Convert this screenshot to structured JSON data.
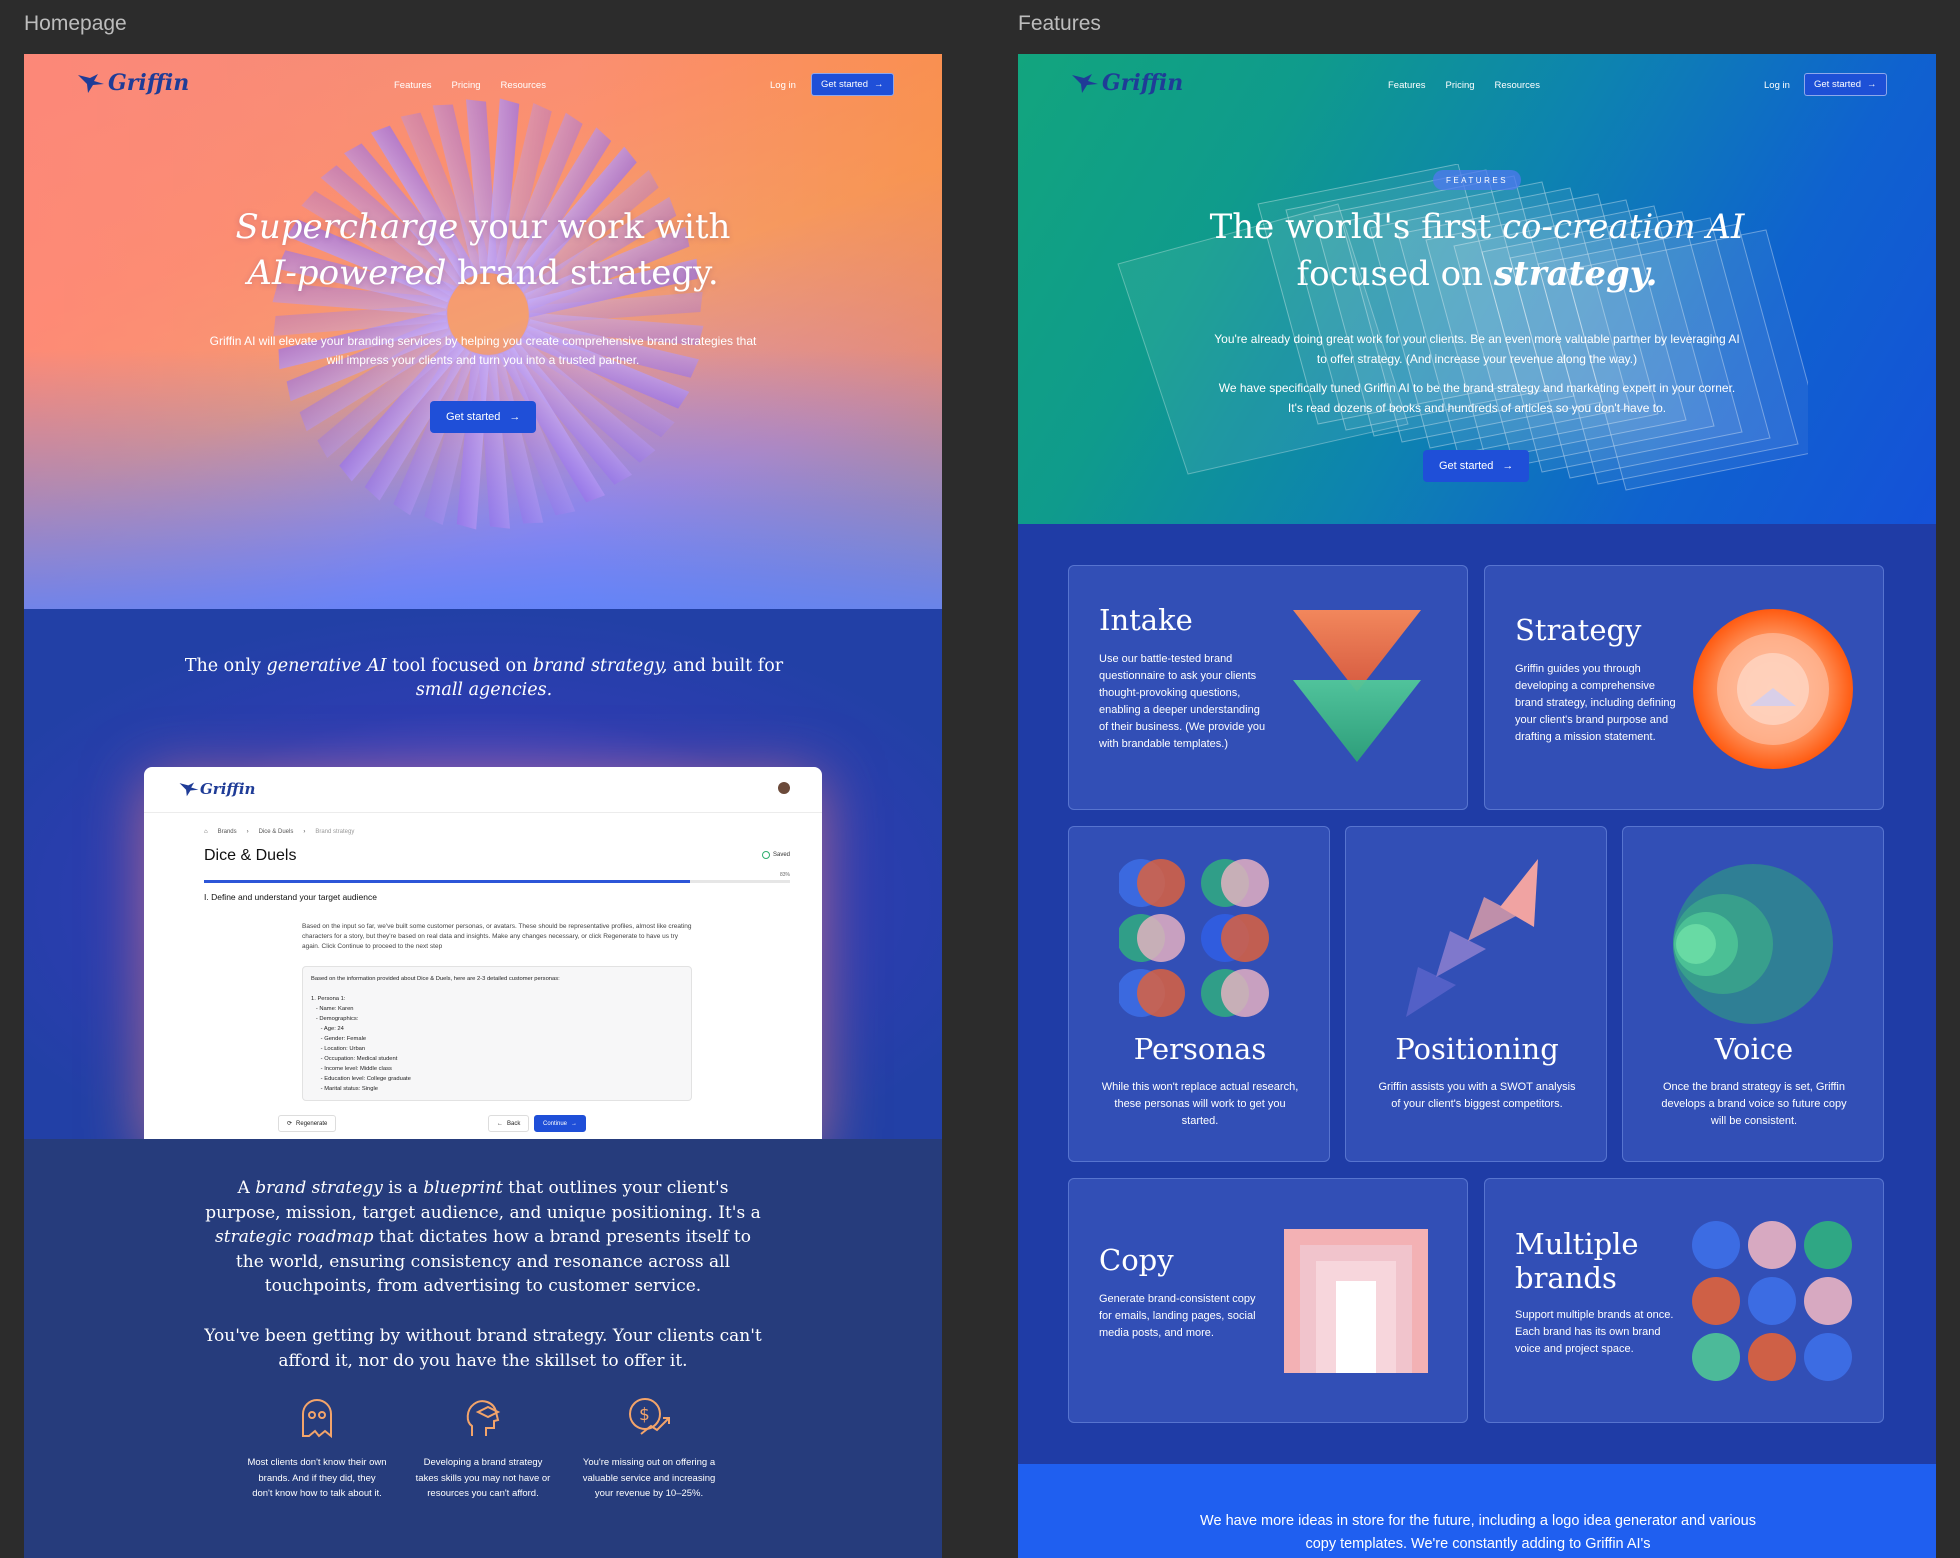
{
  "frames": {
    "homepage_label": "Homepage",
    "features_label": "Features"
  },
  "nav": {
    "brand": "Griffin",
    "links": [
      "Features",
      "Pricing",
      "Resources"
    ],
    "login": "Log in",
    "cta": "Get started"
  },
  "home": {
    "hero_title_1a": "Supercharge",
    "hero_title_1b": " your work with",
    "hero_title_2a": "AI-powered",
    "hero_title_2b": " brand strategy.",
    "hero_sub": "Griffin AI will elevate your branding services by helping you create comprehensive brand strategies that will impress your clients and turn you into a trusted partner.",
    "hero_cta": "Get started",
    "s2_a": "The only ",
    "s2_b": "generative AI",
    "s2_c": " tool focused on ",
    "s2_d": "brand strategy,",
    "s2_e": " and built for ",
    "s2_f": "small agencies.",
    "app": {
      "brand": "Griffin",
      "crumbs": [
        "Brands",
        "Dice & Duels",
        "Brand strategy"
      ],
      "title": "Dice & Duels",
      "saved": "Saved",
      "percent": "83%",
      "progress": 0.83,
      "step": "I. Define and understand your target audience",
      "explain": "Based on the input so far, we've built some customer personas, or avatars. These should be representative profiles, almost like creating characters for a story, but they're based on real data and insights. Make any changes necessary, or click Regenerate to have us try again. Click Continue to proceed to the next step",
      "response": [
        "Based on the information provided about Dice & Duels, here are 2-3 detailed customer personas:",
        "",
        "1. Persona 1:",
        "   - Name: Karen",
        "   - Demographics:",
        "      - Age: 24",
        "      - Gender: Female",
        "      - Location: Urban",
        "      - Occupation: Medical student",
        "      - Income level: Middle class",
        "      - Education level: College graduate",
        "      - Marital status: Single"
      ],
      "regenerate": "Regenerate",
      "back": "Back",
      "continue": "Continue"
    },
    "s3_p1": [
      "A ",
      "brand strategy",
      " is a ",
      "blueprint",
      " that outlines your client's purpose, mission, target audience, and unique positioning. It's a ",
      "strategic roadmap",
      " that dictates how a brand presents itself to the world, ensuring consistency and resonance across all touchpoints, from advertising to customer service."
    ],
    "s3_p2": "You've been getting by without brand strategy. Your clients can't afford it, nor do you have the skillset to offer it.",
    "pains": [
      {
        "icon": "ghost-icon",
        "text": "Most clients don't know their own brands. And if they did, they don't know how to talk about it."
      },
      {
        "icon": "head-graduation-icon",
        "text": "Developing a brand strategy takes skills you may not have or resources you can't afford."
      },
      {
        "icon": "revenue-chart-icon",
        "text": "You're missing out on offering a valuable service and increasing your revenue by 10–25%."
      }
    ]
  },
  "features": {
    "pill": "FEATURES",
    "title_1a": "The world's first ",
    "title_1b": "co-creation AI",
    "title_2a": "focused on ",
    "title_2b": "strategy.",
    "sub1": "You're already doing great work for your clients. Be an even more valuable partner by leveraging AI to offer strategy. (And increase your revenue along the way.)",
    "sub2": "We have specifically tuned Griffin AI to be the brand strategy and marketing expert in your corner. It's read dozens of books and hundreds of articles so you don't have to.",
    "cta": "Get started",
    "cards": {
      "intake": {
        "title": "Intake",
        "text": "Use our battle-tested brand questionnaire to ask your clients thought-provoking questions, enabling a deeper understanding of their business. (We provide you with brandable templates.)"
      },
      "strategy": {
        "title": "Strategy",
        "text": "Griffin guides you through developing a comprehensive brand strategy, including defining your client's brand purpose and drafting a mission statement."
      },
      "personas": {
        "title": "Personas",
        "text": "While this won't replace actual research, these personas will work to get you started."
      },
      "positioning": {
        "title": "Positioning",
        "text": "Griffin assists you with a SWOT analysis of your client's biggest competitors."
      },
      "voice": {
        "title": "Voice",
        "text": "Once the brand strategy is set, Griffin develops a brand voice so future copy will be consistent."
      },
      "copy": {
        "title": "Copy",
        "text": "Generate brand-consistent copy for emails, landing pages, social media posts, and more."
      },
      "multiple": {
        "title_1": "Multiple",
        "title_2": "brands",
        "text": "Support multiple brands at once. Each brand has its own brand voice and project space."
      }
    },
    "bottom": "We have more ideas in store for the future, including a logo idea generator and various copy templates. We're constantly adding to Griffin AI's"
  }
}
